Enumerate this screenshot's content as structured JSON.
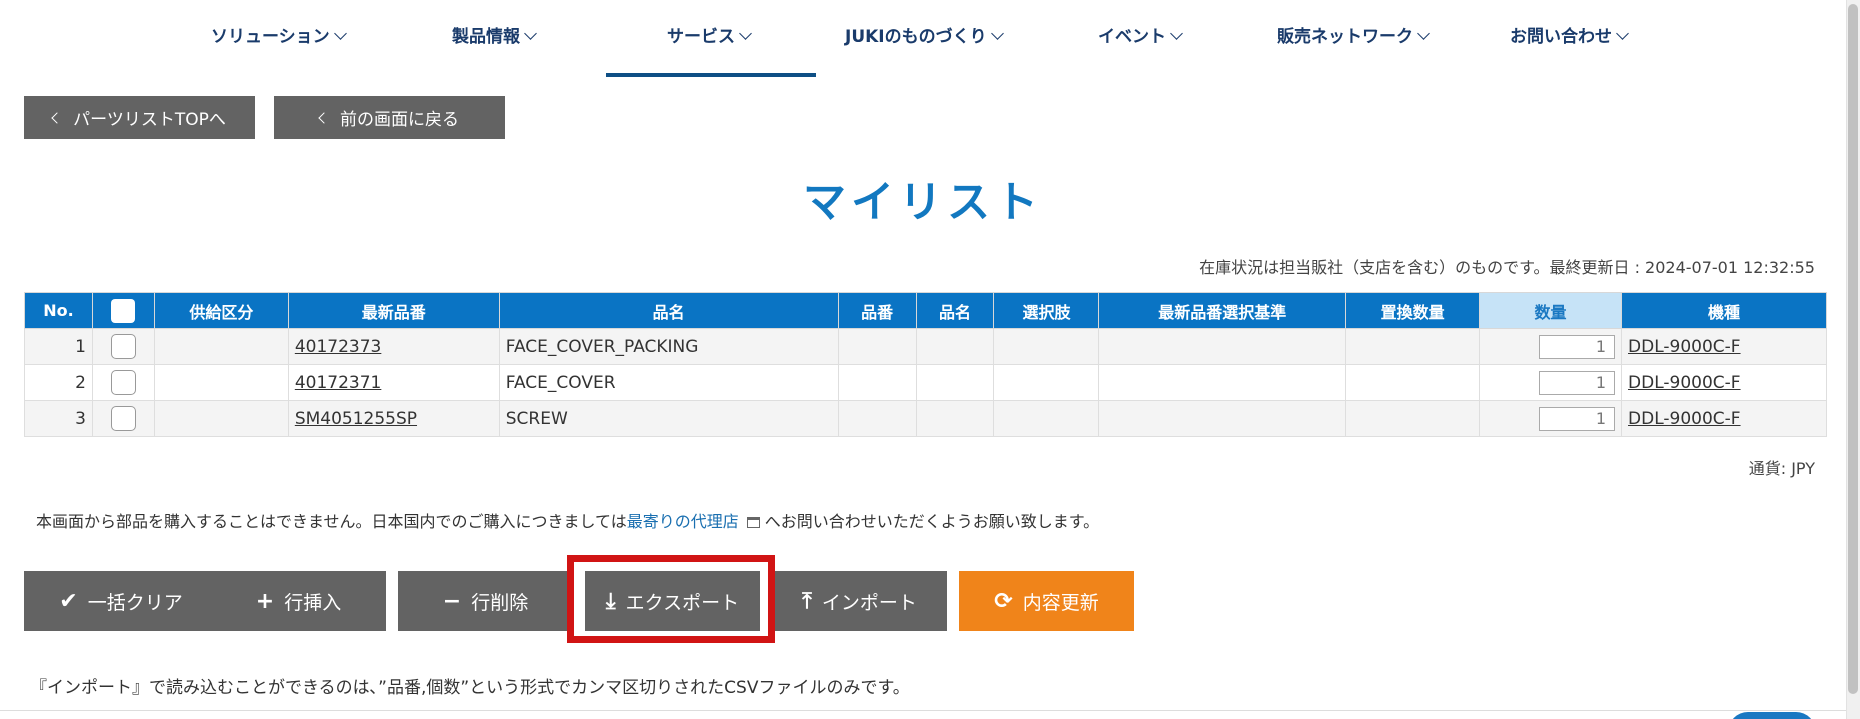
{
  "nav": {
    "items": [
      {
        "label": "ソリューション"
      },
      {
        "label": "製品情報"
      },
      {
        "label": "サービス"
      },
      {
        "label": "JUKIのものづくり"
      },
      {
        "label": "イベント"
      },
      {
        "label": "販売ネットワーク"
      },
      {
        "label": "お問い合わせ"
      }
    ],
    "active": "サービス"
  },
  "buttons": {
    "parts_top": "パーツリストTOPへ",
    "back": "前の画面に戻る"
  },
  "page_title": "マイリスト",
  "stock_note": "在庫状況は担当販社（支店を含む）のものです。最終更新日 : 2024-07-01 12:32:55",
  "table": {
    "headers": [
      "No.",
      "",
      "供給区分",
      "最新品番",
      "品名",
      "品番",
      "品名",
      "選択肢",
      "最新品番選択基準",
      "置換数量",
      "数量",
      "機種"
    ],
    "rows": [
      {
        "no": "1",
        "supply": "",
        "latest_part": "40172373",
        "name": "FACE_COVER_PACKING",
        "part": "",
        "name2": "",
        "option": "",
        "criteria": "",
        "replace_qty": "",
        "qty": "1",
        "model": "DDL-9000C-F"
      },
      {
        "no": "2",
        "supply": "",
        "latest_part": "40172371",
        "name": "FACE_COVER",
        "part": "",
        "name2": "",
        "option": "",
        "criteria": "",
        "replace_qty": "",
        "qty": "1",
        "model": "DDL-9000C-F"
      },
      {
        "no": "3",
        "supply": "",
        "latest_part": "SM4051255SP",
        "name": "SCREW",
        "part": "",
        "name2": "",
        "option": "",
        "criteria": "",
        "replace_qty": "",
        "qty": "1",
        "model": "DDL-9000C-F"
      }
    ]
  },
  "currency": "通貨: JPY",
  "notice": {
    "before": "本画面から部品を購入することはできません。日本国内でのご購入につきましては",
    "link": "最寄りの代理店",
    "after": "へお問い合わせいただくようお願い致します。"
  },
  "actions": {
    "clear": "一括クリア",
    "insert": "行挿入",
    "delete": "行削除",
    "export": "エクスポート",
    "import": "インポート",
    "update": "内容更新"
  },
  "import_note": "『インポート』で読み込むことができるのは､”品番,個数”という形式でカンマ区切りされたCSVファイルのみです。",
  "colors": {
    "header_blue": "#0a74c4",
    "title_blue": "#1278c0",
    "button_gray": "#636363",
    "update_orange": "#f0841a",
    "highlight_red": "#d11414"
  }
}
